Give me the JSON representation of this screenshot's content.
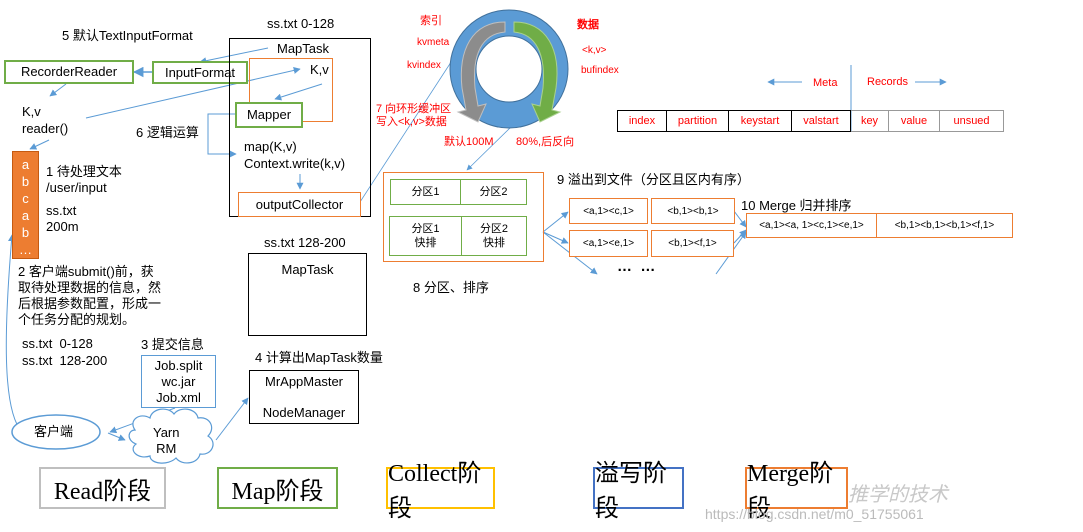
{
  "read_section": {
    "step5_label": "5 默认TextInputFormat",
    "recorder_reader": "RecorderReader",
    "input_format": "InputFormat",
    "kv_label": "K,v",
    "reader_label": "reader()",
    "file_letters": [
      "a",
      "b",
      "c",
      "a",
      "b",
      "…"
    ],
    "step1_label": "1 待处理文本",
    "input_path": "/user/input",
    "file_name": "ss.txt",
    "file_size": "200m",
    "step2_label": [
      "2 客户端submit()前，获",
      "取待处理数据的信息，然",
      "后根据参数配置，形成一",
      "个任务分配的规划。"
    ],
    "splits": [
      "ss.txt  0-128",
      "ss.txt  128-200"
    ],
    "step3_label": "3 提交信息",
    "submit_files": [
      "Job.split",
      "wc.jar",
      "Job.xml"
    ],
    "client_label": "客户端",
    "yarn_label": [
      "Yarn",
      "RM"
    ],
    "step4_label": "4 计算出MapTask数量",
    "app_master": "MrAppMaster",
    "node_manager": "NodeManager"
  },
  "map_section": {
    "split1_title": "ss.txt 0-128",
    "maptask_label": "MapTask",
    "kv_label": "K,v",
    "mapper_label": "Mapper",
    "step6_label": "6 逻辑运算",
    "map_call": "map(K,v)",
    "context_write": "Context.write(k,v)",
    "output_collector": "outputCollector",
    "split2_title": "ss.txt 128-200",
    "maptask2_label": "MapTask"
  },
  "ring_buffer": {
    "index_label": "索引",
    "kvmeta": "kvmeta",
    "kvindex": "kvindex",
    "data_label": "数据",
    "kv_type": "<k,v>",
    "bufindex": "bufindex",
    "step7_label": [
      "7 向环形缓冲区",
      "写入<k,v>数据"
    ],
    "default_size": "默认100M",
    "threshold": "80%,后反向",
    "colors": {
      "ring": "#5b9bd5",
      "index_arrow": "#8c8c8c",
      "data_arrow": "#70ad47"
    }
  },
  "buffer_layout": {
    "meta_label": "Meta",
    "records_label": "Records",
    "meta_columns": [
      "index",
      "partition",
      "keystart",
      "valstart"
    ],
    "record_columns": [
      "key",
      "value",
      "unsued"
    ]
  },
  "partition_section": {
    "partitions": [
      "分区1",
      "分区2"
    ],
    "sorted_partitions": [
      [
        "分区1",
        "快排"
      ],
      [
        "分区2",
        "快排"
      ]
    ],
    "step8_label": "8 分区、排序"
  },
  "spill_section": {
    "step9_label": "9 溢出到文件（分区且区内有序）",
    "spill_files": [
      [
        "<a,1><c,1>",
        "<b,1><b,1>"
      ],
      [
        "<a,1><e,1>",
        "<b,1><f,1>"
      ]
    ],
    "ellipsis": "…  …"
  },
  "merge_section": {
    "step10_label": "10 Merge 归并排序",
    "merged": [
      "<a,1><a, 1><c,1><e,1>",
      "<b,1><b,1><b,1><f,1>"
    ]
  },
  "stages": [
    {
      "label": "Read阶段",
      "color": "#bfbfbf"
    },
    {
      "label": "Map阶段",
      "color": "#70ad47"
    },
    {
      "label": "Collect阶段",
      "color": "#ffc000"
    },
    {
      "label": "溢写阶段",
      "color": "#4472c4"
    },
    {
      "label": "Merge阶段",
      "color": "#ed7d31"
    }
  ],
  "watermark": {
    "brand": "推学的技术",
    "url": "https://blog.csdn.net/m0_51755061"
  }
}
